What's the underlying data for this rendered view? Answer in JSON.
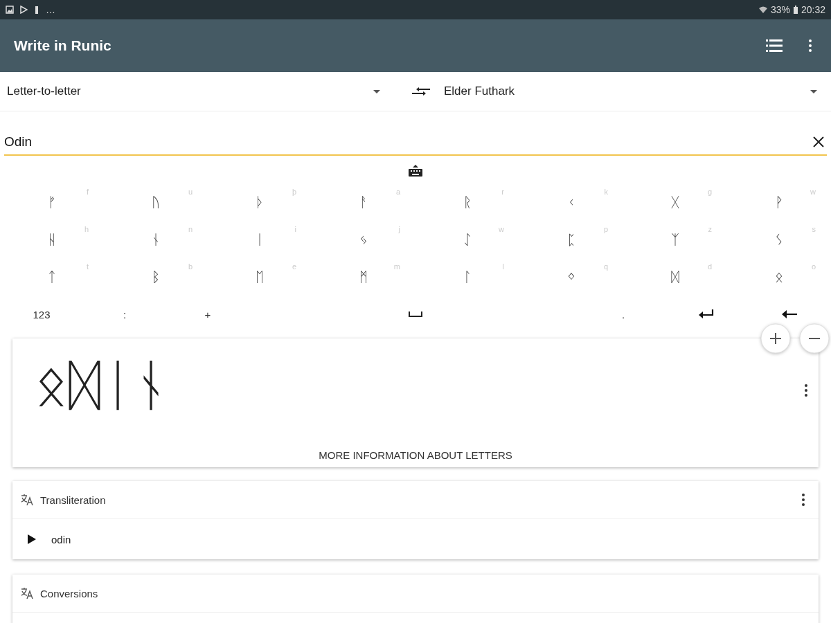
{
  "status_bar": {
    "overflow": "…",
    "battery": "33%",
    "time": "20:32"
  },
  "app_bar": {
    "title": "Write in Runic"
  },
  "mode_dropdown": {
    "value": "Letter-to-letter"
  },
  "alphabet_dropdown": {
    "value": "Elder Futhark"
  },
  "input": {
    "value": "Odin"
  },
  "keyboard": {
    "rows": [
      [
        {
          "rune": "ᚠ",
          "hint": "f"
        },
        {
          "rune": "ᚢ",
          "hint": "u"
        },
        {
          "rune": "ᚦ",
          "hint": "þ"
        },
        {
          "rune": "ᚨ",
          "hint": "a"
        },
        {
          "rune": "ᚱ",
          "hint": "r"
        },
        {
          "rune": "ᚲ",
          "hint": "k"
        },
        {
          "rune": "ᚷ",
          "hint": "g"
        },
        {
          "rune": "ᚹ",
          "hint": "w"
        }
      ],
      [
        {
          "rune": "ᚺ",
          "hint": "h"
        },
        {
          "rune": "ᚾ",
          "hint": "n"
        },
        {
          "rune": "ᛁ",
          "hint": "i"
        },
        {
          "rune": "ᛃ",
          "hint": "j"
        },
        {
          "rune": "ᛇ",
          "hint": "w"
        },
        {
          "rune": "ᛈ",
          "hint": "p"
        },
        {
          "rune": "ᛉ",
          "hint": "z"
        },
        {
          "rune": "ᛊ",
          "hint": "s"
        }
      ],
      [
        {
          "rune": "ᛏ",
          "hint": "t"
        },
        {
          "rune": "ᛒ",
          "hint": "b"
        },
        {
          "rune": "ᛖ",
          "hint": "e"
        },
        {
          "rune": "ᛗ",
          "hint": "m"
        },
        {
          "rune": "ᛚ",
          "hint": "l"
        },
        {
          "rune": "ᛜ",
          "hint": "q"
        },
        {
          "rune": "ᛞ",
          "hint": "d"
        },
        {
          "rune": "ᛟ",
          "hint": "o"
        }
      ]
    ],
    "bottom_row": [
      {
        "kind": "text",
        "label": "123"
      },
      {
        "kind": "text",
        "label": ":"
      },
      {
        "kind": "text",
        "label": "+"
      },
      {
        "kind": "space"
      },
      {
        "kind": "text",
        "label": "."
      },
      {
        "kind": "enter"
      },
      {
        "kind": "backspace"
      }
    ]
  },
  "output_card": {
    "runes": "ᛟᛞᛁᚾ",
    "link": "MORE INFORMATION ABOUT LETTERS"
  },
  "transliteration_card": {
    "title": "Transliteration",
    "value": "odin"
  },
  "conversions_card": {
    "title": "Conversions"
  }
}
